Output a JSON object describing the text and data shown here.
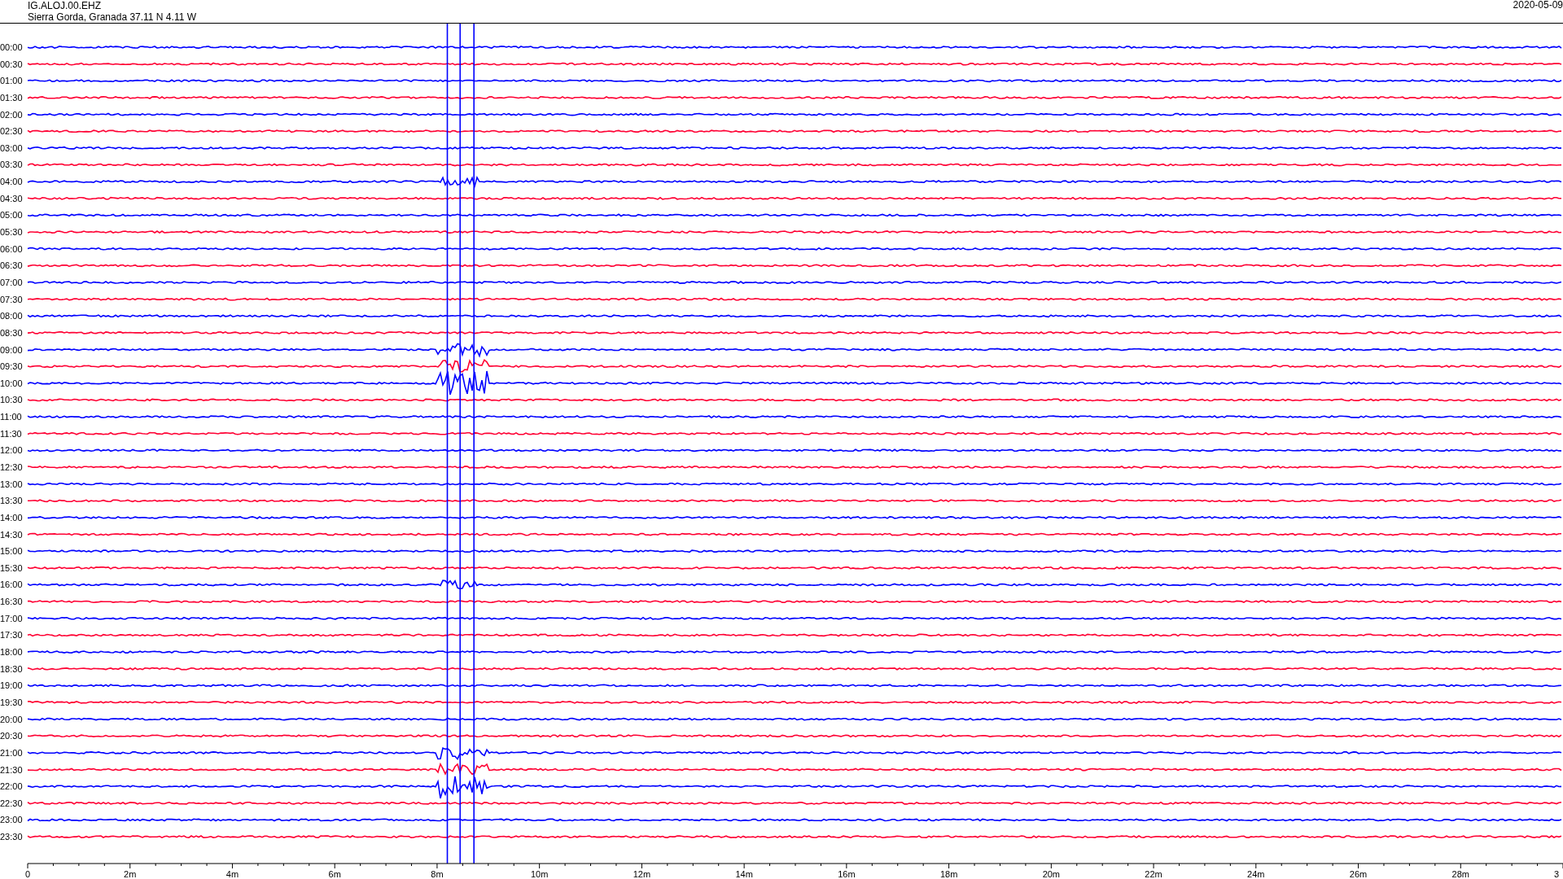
{
  "header": {
    "station": "IG.ALOJ.00.EHZ",
    "location": "Sierra Gorda, Granada  37.11 N 4.11 W",
    "date": "2020-05-09"
  },
  "traces": [
    {
      "label": "00:00",
      "color": "#0000ff"
    },
    {
      "label": "00:30",
      "color": "#ff0033"
    },
    {
      "label": "01:00",
      "color": "#0000ff"
    },
    {
      "label": "01:30",
      "color": "#ff0033"
    },
    {
      "label": "02:00",
      "color": "#0000ff"
    },
    {
      "label": "02:30",
      "color": "#ff0033"
    },
    {
      "label": "03:00",
      "color": "#0000ff"
    },
    {
      "label": "03:30",
      "color": "#ff0033"
    },
    {
      "label": "04:00",
      "color": "#0000ff"
    },
    {
      "label": "04:30",
      "color": "#ff0033"
    },
    {
      "label": "05:00",
      "color": "#0000ff"
    },
    {
      "label": "05:30",
      "color": "#ff0033"
    },
    {
      "label": "06:00",
      "color": "#0000ff"
    },
    {
      "label": "06:30",
      "color": "#ff0033"
    },
    {
      "label": "07:00",
      "color": "#0000ff"
    },
    {
      "label": "07:30",
      "color": "#ff0033"
    },
    {
      "label": "08:00",
      "color": "#0000ff"
    },
    {
      "label": "08:30",
      "color": "#ff0033"
    },
    {
      "label": "09:00",
      "color": "#0000ff"
    },
    {
      "label": "09:30",
      "color": "#ff0033"
    },
    {
      "label": "10:00",
      "color": "#0000ff"
    },
    {
      "label": "10:30",
      "color": "#ff0033"
    },
    {
      "label": "11:00",
      "color": "#0000ff"
    },
    {
      "label": "11:30",
      "color": "#ff0033"
    },
    {
      "label": "12:00",
      "color": "#0000ff"
    },
    {
      "label": "12:30",
      "color": "#ff0033"
    },
    {
      "label": "13:00",
      "color": "#0000ff"
    },
    {
      "label": "13:30",
      "color": "#ff0033"
    },
    {
      "label": "14:00",
      "color": "#0000ff"
    },
    {
      "label": "14:30",
      "color": "#ff0033"
    },
    {
      "label": "15:00",
      "color": "#0000ff"
    },
    {
      "label": "15:30",
      "color": "#ff0033"
    },
    {
      "label": "16:00",
      "color": "#0000ff"
    },
    {
      "label": "16:30",
      "color": "#ff0033"
    },
    {
      "label": "17:00",
      "color": "#0000ff"
    },
    {
      "label": "17:30",
      "color": "#ff0033"
    },
    {
      "label": "18:00",
      "color": "#0000ff"
    },
    {
      "label": "18:30",
      "color": "#ff0033"
    },
    {
      "label": "19:00",
      "color": "#0000ff"
    },
    {
      "label": "19:30",
      "color": "#ff0033"
    },
    {
      "label": "20:00",
      "color": "#0000ff"
    },
    {
      "label": "20:30",
      "color": "#ff0033"
    },
    {
      "label": "21:00",
      "color": "#0000ff"
    },
    {
      "label": "21:30",
      "color": "#ff0033"
    },
    {
      "label": "22:00",
      "color": "#0000ff"
    },
    {
      "label": "22:30",
      "color": "#ff0033"
    },
    {
      "label": "23:00",
      "color": "#0000ff"
    },
    {
      "label": "23:30",
      "color": "#ff0033"
    }
  ],
  "axis": {
    "ticks": [
      "0",
      "2m",
      "4m",
      "6m",
      "8m",
      "10m",
      "12m",
      "14m",
      "16m",
      "18m",
      "20m",
      "22m",
      "24m",
      "26m",
      "28m",
      "3"
    ]
  }
}
